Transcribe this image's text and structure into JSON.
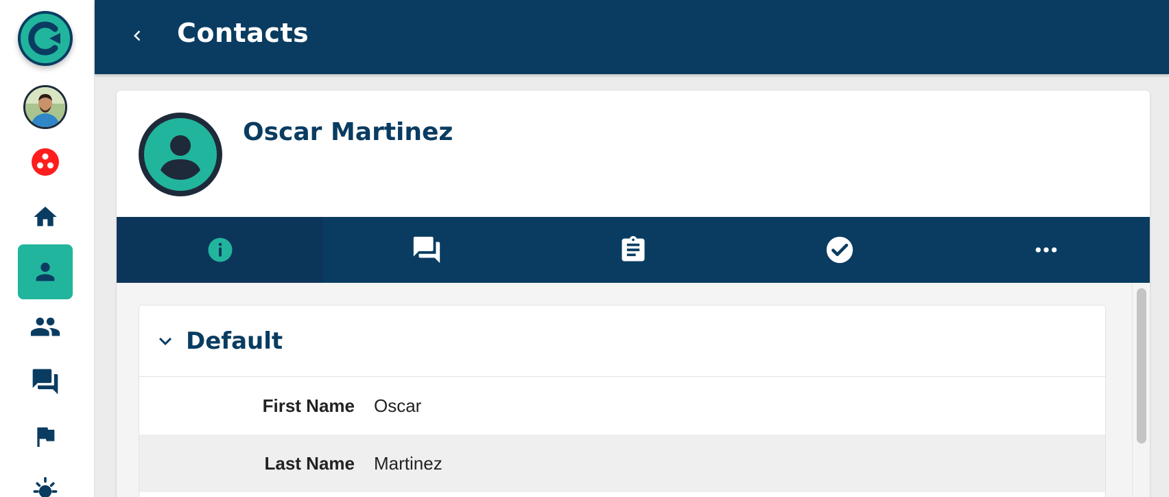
{
  "header": {
    "title": "Contacts",
    "back_icon": "chevron-left-icon"
  },
  "sidebar": {
    "items": [
      {
        "name": "logo",
        "icon": "brand-logo-icon"
      },
      {
        "name": "user-avatar",
        "icon": "avatar-photo"
      },
      {
        "name": "apps",
        "icon": "dots-cluster-icon",
        "color": "#ff1e1e"
      },
      {
        "name": "home",
        "icon": "home-icon"
      },
      {
        "name": "contacts",
        "icon": "person-icon",
        "active": true
      },
      {
        "name": "groups",
        "icon": "people-icon"
      },
      {
        "name": "conversations",
        "icon": "forum-icon"
      },
      {
        "name": "flags",
        "icon": "flag-icon"
      },
      {
        "name": "theme",
        "icon": "sun-icon"
      }
    ]
  },
  "contact": {
    "name": "Oscar Martinez",
    "avatar_icon": "account-circle-icon"
  },
  "tabs": [
    {
      "icon": "info-icon",
      "active": true
    },
    {
      "icon": "forum-icon"
    },
    {
      "icon": "clipboard-icon"
    },
    {
      "icon": "check-circle-icon"
    },
    {
      "icon": "more-horizontal-icon"
    }
  ],
  "section": {
    "title": "Default",
    "collapse_icon": "chevron-down-icon",
    "fields": [
      {
        "label": "First Name",
        "value": "Oscar"
      },
      {
        "label": "Last Name",
        "value": "Martinez"
      }
    ]
  },
  "colors": {
    "primary": "#0a3c61",
    "accent": "#22b59d",
    "apps_red": "#ff1e1e"
  }
}
